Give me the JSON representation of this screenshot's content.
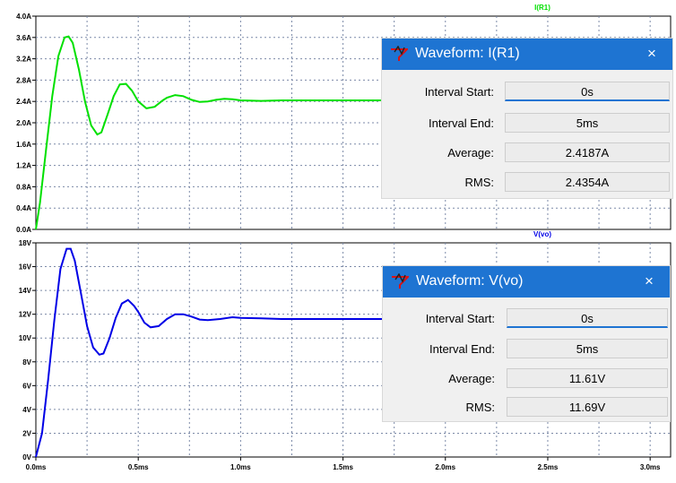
{
  "plots": [
    {
      "trace_label": "I(R1)",
      "trace_color": "#00e000",
      "y_ticks": [
        "0.0A",
        "0.4A",
        "0.8A",
        "1.2A",
        "1.6A",
        "2.0A",
        "2.4A",
        "2.8A",
        "3.2A",
        "3.6A",
        "4.0A"
      ],
      "chart_data": {
        "type": "line",
        "series": [
          {
            "name": "I(R1)",
            "x": [
              0,
              0.02,
              0.05,
              0.08,
              0.11,
              0.14,
              0.16,
              0.18,
              0.21,
              0.24,
              0.27,
              0.3,
              0.32,
              0.35,
              0.38,
              0.41,
              0.44,
              0.47,
              0.5,
              0.54,
              0.58,
              0.62,
              0.64,
              0.68,
              0.72,
              0.76,
              0.8,
              0.84,
              0.88,
              0.92,
              0.96,
              1.0,
              1.1,
              1.2,
              1.3,
              1.4,
              1.5,
              1.6,
              1.7,
              1.76
            ],
            "y": [
              0.0,
              0.5,
              1.5,
              2.5,
              3.25,
              3.6,
              3.62,
              3.5,
              3.0,
              2.4,
              1.95,
              1.78,
              1.82,
              2.15,
              2.5,
              2.72,
              2.73,
              2.6,
              2.4,
              2.27,
              2.3,
              2.42,
              2.47,
              2.52,
              2.5,
              2.43,
              2.39,
              2.4,
              2.43,
              2.45,
              2.44,
              2.42,
              2.41,
              2.42,
              2.42,
              2.42,
              2.42,
              2.42,
              2.42,
              2.42
            ]
          }
        ],
        "xlim": [
          0,
          3.1
        ],
        "ylim": [
          0,
          4.0
        ],
        "grid": true
      }
    },
    {
      "trace_label": "V(vo)",
      "trace_color": "#0000e6",
      "y_ticks": [
        "0V",
        "2V",
        "4V",
        "6V",
        "8V",
        "10V",
        "12V",
        "14V",
        "16V",
        "18V"
      ],
      "chart_data": {
        "type": "line",
        "series": [
          {
            "name": "V(vo)",
            "x": [
              0,
              0.03,
              0.06,
              0.09,
              0.12,
              0.15,
              0.17,
              0.19,
              0.22,
              0.25,
              0.28,
              0.31,
              0.33,
              0.36,
              0.39,
              0.42,
              0.45,
              0.48,
              0.5,
              0.53,
              0.56,
              0.6,
              0.64,
              0.68,
              0.72,
              0.76,
              0.8,
              0.84,
              0.9,
              0.96,
              1.0,
              1.1,
              1.2,
              1.3,
              1.4,
              1.5,
              1.6,
              1.7,
              1.75
            ],
            "y": [
              0.0,
              2.0,
              6.5,
              11.5,
              15.8,
              17.5,
              17.5,
              16.5,
              13.8,
              11.0,
              9.2,
              8.6,
              8.7,
              10.0,
              11.7,
              12.9,
              13.2,
              12.7,
              12.2,
              11.3,
              10.9,
              11.0,
              11.6,
              12.0,
              12.0,
              11.8,
              11.55,
              11.5,
              11.6,
              11.75,
              11.7,
              11.65,
              11.6,
              11.6,
              11.6,
              11.6,
              11.6,
              11.6,
              11.6
            ]
          }
        ],
        "xlim": [
          0,
          3.1
        ],
        "ylim": [
          0,
          18
        ],
        "grid": true
      }
    }
  ],
  "x_ticks": [
    "0.0ms",
    "0.5ms",
    "1.0ms",
    "1.5ms",
    "2.0ms",
    "2.5ms",
    "3.0ms"
  ],
  "dialogs": [
    {
      "title": "Waveform: I(R1)",
      "close_glyph": "×",
      "rows": [
        {
          "label": "Interval Start:",
          "value": "0s"
        },
        {
          "label": "Interval End:",
          "value": "5ms"
        },
        {
          "label": "Average:",
          "value": "2.4187A"
        },
        {
          "label": "RMS:",
          "value": "2.4354A"
        }
      ]
    },
    {
      "title": "Waveform: V(vo)",
      "close_glyph": "×",
      "rows": [
        {
          "label": "Interval Start:",
          "value": "0s"
        },
        {
          "label": "Interval End:",
          "value": "5ms"
        },
        {
          "label": "Average:",
          "value": "11.61V"
        },
        {
          "label": "RMS:",
          "value": "11.69V"
        }
      ]
    }
  ],
  "colors": {
    "grid": "#7c8aa8",
    "titlebar": "#1e74d2"
  },
  "icons": {
    "dialog_icon": "ltspice-probe-icon",
    "close": "close-icon"
  }
}
